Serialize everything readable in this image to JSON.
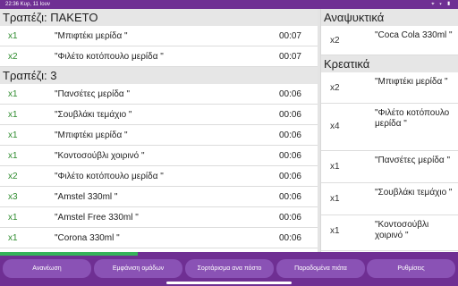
{
  "status_bar": {
    "time": "22:36 Κυρ, 11 Ιουν",
    "icons": "⌖ ▾ ▮"
  },
  "left_sections": [
    {
      "title": "Τραπέζι: ΠΑΚΕΤΟ",
      "items": [
        {
          "qty": "x1",
          "name": "\"Μπιφτέκι μερίδα \"",
          "time": "00:07"
        },
        {
          "qty": "x2",
          "name": "\"Φιλέτο κοτόπουλο μερίδα \"",
          "time": "00:07"
        }
      ]
    },
    {
      "title": "Τραπέζι: 3",
      "items": [
        {
          "qty": "x1",
          "name": "\"Πανσέτες μερίδα \"",
          "time": "00:06"
        },
        {
          "qty": "x1",
          "name": "\"Σουβλάκι τεμάχιο \"",
          "time": "00:06"
        },
        {
          "qty": "x1",
          "name": "\"Μπιφτέκι μερίδα \"",
          "time": "00:06"
        },
        {
          "qty": "x1",
          "name": "\"Κοντοσούβλι χοιρινό \"",
          "time": "00:06"
        },
        {
          "qty": "x2",
          "name": "\"Φιλέτο κοτόπουλο μερίδα \"",
          "time": "00:06"
        },
        {
          "qty": "x3",
          "name": "\"Amstel 330ml \"",
          "time": "00:06"
        },
        {
          "qty": "x1",
          "name": "\"Amstel Free 330ml \"",
          "time": "00:06"
        },
        {
          "qty": "x1",
          "name": "\"Corona 330ml \"",
          "time": "00:06"
        }
      ]
    }
  ],
  "right_sections": [
    {
      "title": "Αναψυκτικά",
      "items": [
        {
          "qty": "x2",
          "name": "\"Coca Cola 330ml \""
        }
      ]
    },
    {
      "title": "Κρεατικά",
      "items": [
        {
          "qty": "x2",
          "name": "\"Μπιφτέκι μερίδα \""
        },
        {
          "qty": "x4",
          "name": "\"Φιλέτο κοτόπουλο μερίδα \""
        },
        {
          "qty": "x1",
          "name": "\"Πανσέτες μερίδα \""
        },
        {
          "qty": "x1",
          "name": "\"Σουβλάκι τεμάχιο \""
        },
        {
          "qty": "x1",
          "name": "\"Κοντοσούβλι χοιρινό \""
        }
      ]
    }
  ],
  "toolbar": {
    "refresh": "Ανανέωση",
    "show_groups": "Εμφάνιση ομάδων",
    "sort_by_station": "Σορτάρισμα ανα πόστο",
    "delivered_dishes": "Παραδομένα πιάτα",
    "settings": "Ρυθμίσεις"
  },
  "colors": {
    "accent": "#6f2f93",
    "button": "#8a52b5",
    "quantity": "#2e8b2e",
    "progress": "#35b35a"
  },
  "progress_fraction": 0.3
}
